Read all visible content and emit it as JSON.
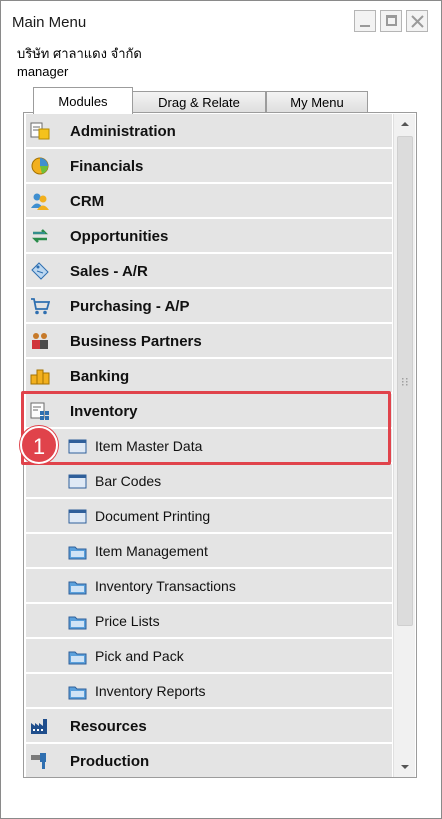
{
  "window": {
    "title": "Main Menu",
    "company": "บริษัท ศาลาแดง จำกัด",
    "user": "manager"
  },
  "tabs": [
    {
      "label": "Modules",
      "active": true
    },
    {
      "label": "Drag & Relate",
      "active": false
    },
    {
      "label": "My Menu",
      "active": false
    }
  ],
  "modules_list": [
    {
      "label": "Administration",
      "level": "module",
      "icon": "administration-icon"
    },
    {
      "label": "Financials",
      "level": "module",
      "icon": "financials-icon"
    },
    {
      "label": "CRM",
      "level": "module",
      "icon": "crm-icon"
    },
    {
      "label": "Opportunities",
      "level": "module",
      "icon": "opportunities-icon"
    },
    {
      "label": "Sales - A/R",
      "level": "module",
      "icon": "sales-icon"
    },
    {
      "label": "Purchasing - A/P",
      "level": "module",
      "icon": "purchasing-icon"
    },
    {
      "label": "Business Partners",
      "level": "module",
      "icon": "business-partners-icon"
    },
    {
      "label": "Banking",
      "level": "module",
      "icon": "banking-icon"
    },
    {
      "label": "Inventory",
      "level": "module",
      "icon": "inventory-icon"
    },
    {
      "label": "Item Master Data",
      "level": "item",
      "icon": "form-icon"
    },
    {
      "label": "Bar Codes",
      "level": "item",
      "icon": "form-icon"
    },
    {
      "label": "Document Printing",
      "level": "item",
      "icon": "form-icon"
    },
    {
      "label": "Item Management",
      "level": "item",
      "icon": "folder-icon"
    },
    {
      "label": "Inventory Transactions",
      "level": "item",
      "icon": "folder-icon"
    },
    {
      "label": "Price Lists",
      "level": "item",
      "icon": "folder-icon"
    },
    {
      "label": "Pick and Pack",
      "level": "item",
      "icon": "folder-icon"
    },
    {
      "label": "Inventory Reports",
      "level": "item",
      "icon": "folder-icon"
    },
    {
      "label": "Resources",
      "level": "module",
      "icon": "resources-icon"
    },
    {
      "label": "Production",
      "level": "module",
      "icon": "production-icon"
    }
  ],
  "annotation": {
    "step_number": "1",
    "color": "#e0434b"
  }
}
